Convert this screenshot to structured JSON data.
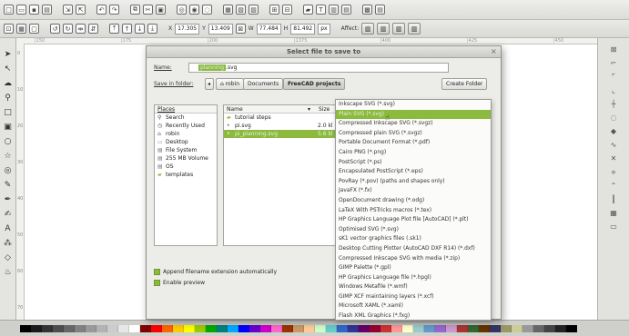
{
  "toolbar": {
    "x_label": "X",
    "x_value": "17.305",
    "y_label": "Y",
    "y_value": "13.409",
    "w_label": "W",
    "w_value": "77.484",
    "h_label": "H",
    "h_value": "81.492",
    "unit": "px",
    "affect_label": "Affect:"
  },
  "ruler": {
    "h_ticks": [
      "|150",
      "|175",
      "|200",
      "|1375",
      "|400",
      "|425",
      "|450"
    ],
    "v_ticks": [
      "0",
      "10",
      "20",
      "30",
      "40",
      "50",
      "60",
      "70"
    ]
  },
  "dialog": {
    "title": "Select file to save to",
    "close": "×",
    "name_label": "Name:",
    "name_selected": "planning",
    "name_ext": ".svg",
    "save_in_label": "Save in folder:",
    "back": "◂",
    "crumbs": [
      "robin",
      "Documents",
      "FreeCAD projects"
    ],
    "create_folder": "Create Folder",
    "places_header": "Places",
    "places": [
      {
        "label": "Search",
        "icon": "search-icon"
      },
      {
        "label": "Recently Used",
        "icon": "clock-icon"
      },
      {
        "label": "robin",
        "icon": "home-icon"
      },
      {
        "label": "Desktop",
        "icon": "desktop-icon"
      },
      {
        "label": "File System",
        "icon": "drive-icon"
      },
      {
        "label": "255 MB Volume",
        "icon": "drive-icon"
      },
      {
        "label": "OS",
        "icon": "drive-icon"
      },
      {
        "label": "templates",
        "icon": "folder-icon"
      }
    ],
    "files_header_name": "Name",
    "files_header_size": "Size",
    "files": [
      {
        "name": "tutorial steps",
        "size": "",
        "icon": "folder-icon"
      },
      {
        "name": "pi.svg",
        "size": "2.0 kl",
        "icon": "file-icon"
      },
      {
        "name": "pi_planning.svg",
        "size": "5.6 kl",
        "icon": "file-icon"
      }
    ],
    "append_label": "Append filename extension automatically",
    "preview_label": "Enable preview",
    "file_types": [
      "Inkscape SVG (*.svg)",
      "Plain SVG (*.svg)",
      "Compressed Inkscape SVG (*.svgz)",
      "Compressed plain SVG (*.svgz)",
      "Portable Document Format (*.pdf)",
      "Cairo PNG (*.png)",
      "PostScript (*.ps)",
      "Encapsulated PostScript (*.eps)",
      "PovRay (*.pov) (paths and shapes only)",
      "JavaFX (*.fx)",
      "OpenDocument drawing (*.odg)",
      "LaTeX With PSTricks macros (*.tex)",
      "HP Graphics Language Plot file [AutoCAD] (*.plt)",
      "Optimised SVG (*.svg)",
      "sK1 vector graphics files (.sk1)",
      "Desktop Cutting Plotter (AutoCAD DXF R14) (*.dxf)",
      "Compressed Inkscape SVG with media (*.zip)",
      "GIMP Palette (*.gpl)",
      "HP Graphics Language file (*.hpgl)",
      "Windows Metafile (*.wmf)",
      "GIMP XCF maintaining layers (*.xcf)",
      "Microsoft XAML (*.xaml)",
      "Flash XML Graphics (*.fxg)"
    ],
    "highlighted_index": 1
  },
  "palette_colors": [
    "#000000",
    "#1a1a1a",
    "#333333",
    "#4d4d4d",
    "#666666",
    "#808080",
    "#999999",
    "#b3b3b3",
    "#cccccc",
    "#e6e6e6",
    "#ffffff",
    "#800000",
    "#ff0000",
    "#ff6600",
    "#ffcc00",
    "#ffff00",
    "#99cc00",
    "#00aa00",
    "#008080",
    "#00aaff",
    "#0000ff",
    "#6600cc",
    "#cc00cc",
    "#ff66cc",
    "#993300",
    "#cc9966",
    "#ffcc99",
    "#ccffcc",
    "#66cccc",
    "#3366cc",
    "#333399",
    "#660066",
    "#990033",
    "#cc3333",
    "#ff9999",
    "#ffffcc",
    "#99cccc",
    "#6699cc",
    "#9966cc",
    "#cc99cc",
    "#aa3333",
    "#336633",
    "#663300",
    "#333366",
    "#999966",
    "#cccc99",
    "#999999",
    "#666666",
    "#444444",
    "#222222",
    "#000000"
  ],
  "accent": "#8bba3f"
}
